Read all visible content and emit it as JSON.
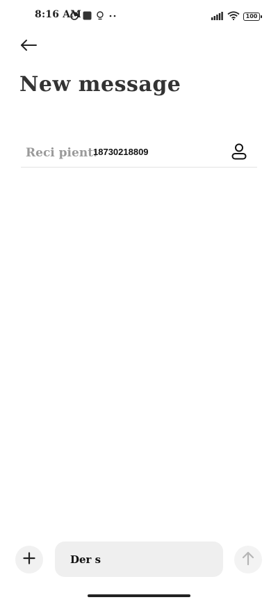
{
  "status_bar": {
    "time": "8:16 AM",
    "battery": "100",
    "icons_left": [
      "sync-icon",
      "app-square-icon",
      "bulb-icon",
      "more-dots-icon"
    ],
    "icons_right": [
      "signal-icon",
      "wifi-icon",
      "battery-icon"
    ]
  },
  "header": {
    "back_icon": "arrow-left-icon",
    "title": "New message"
  },
  "recipient": {
    "label": "Reci pient:",
    "value": "18730218809",
    "contact_icon": "person-icon"
  },
  "composer": {
    "add_icon": "plus-icon",
    "text": "Der s",
    "send_icon": "arrow-up-icon"
  },
  "colors": {
    "background": "#ffffff",
    "title": "#333333",
    "label": "#9a9a9a",
    "input_bg": "#efefef",
    "divider": "#e3e3e3",
    "send_disabled": "#b5b5b5"
  }
}
